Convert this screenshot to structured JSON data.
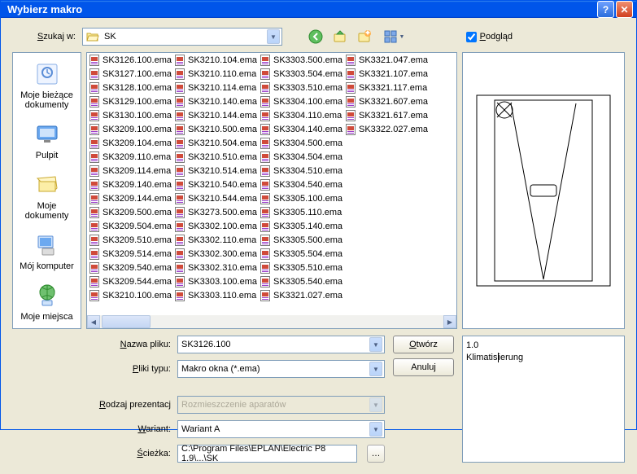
{
  "title": "Wybierz makro",
  "searchIn": {
    "label": "Szukaj w:",
    "value": "SK"
  },
  "previewLabel": "Podgląd",
  "places": [
    {
      "label": "Moje bieżące dokumenty"
    },
    {
      "label": "Pulpit"
    },
    {
      "label": "Moje dokumenty"
    },
    {
      "label": "Mój komputer"
    },
    {
      "label": "Moje miejsca"
    }
  ],
  "files": [
    "SK3126.100.ema",
    "SK3127.100.ema",
    "SK3128.100.ema",
    "SK3129.100.ema",
    "SK3130.100.ema",
    "SK3209.100.ema",
    "SK3209.104.ema",
    "SK3209.110.ema",
    "SK3209.114.ema",
    "SK3209.140.ema",
    "SK3209.144.ema",
    "SK3209.500.ema",
    "SK3209.504.ema",
    "SK3209.510.ema",
    "SK3209.514.ema",
    "SK3209.540.ema",
    "SK3209.544.ema",
    "SK3210.100.ema",
    "SK3210.104.ema",
    "SK3210.110.ema",
    "SK3210.114.ema",
    "SK3210.140.ema",
    "SK3210.144.ema",
    "SK3210.500.ema",
    "SK3210.504.ema",
    "SK3210.510.ema",
    "SK3210.514.ema",
    "SK3210.540.ema",
    "SK3210.544.ema",
    "SK3273.500.ema",
    "SK3302.100.ema",
    "SK3302.110.ema",
    "SK3302.300.ema",
    "SK3302.310.ema",
    "SK3303.100.ema",
    "SK3303.110.ema",
    "SK3303.500.ema",
    "SK3303.504.ema",
    "SK3303.510.ema",
    "SK3304.100.ema",
    "SK3304.110.ema",
    "SK3304.140.ema",
    "SK3304.500.ema",
    "SK3304.504.ema",
    "SK3304.510.ema",
    "SK3304.540.ema",
    "SK3305.100.ema",
    "SK3305.110.ema",
    "SK3305.140.ema",
    "SK3305.500.ema",
    "SK3305.504.ema",
    "SK3305.510.ema",
    "SK3305.540.ema",
    "SK3321.027.ema",
    "SK3321.047.ema",
    "SK3321.107.ema",
    "SK3321.117.ema",
    "SK3321.607.ema",
    "SK3321.617.ema",
    "SK3322.027.ema"
  ],
  "fields": {
    "fileNameLabel": "Nazwa pliku:",
    "fileName": "SK3126.100",
    "fileTypeLabel": "Pliki typu:",
    "fileType": "Makro okna (*.ema)",
    "presentationLabel": "Rodzaj prezentacj",
    "presentation": "Rozmieszczenie aparatów",
    "variantLabel": "Wariant:",
    "variant": "Wariant A",
    "pathLabel": "Ścieżka:",
    "path": "C:\\Program Files\\EPLAN\\Electric P8 1.9\\...\\SK"
  },
  "buttons": {
    "open": "Otwórz",
    "cancel": "Anuluj"
  },
  "info": {
    "line1": "1.0",
    "line2": "Klimatisierung"
  }
}
